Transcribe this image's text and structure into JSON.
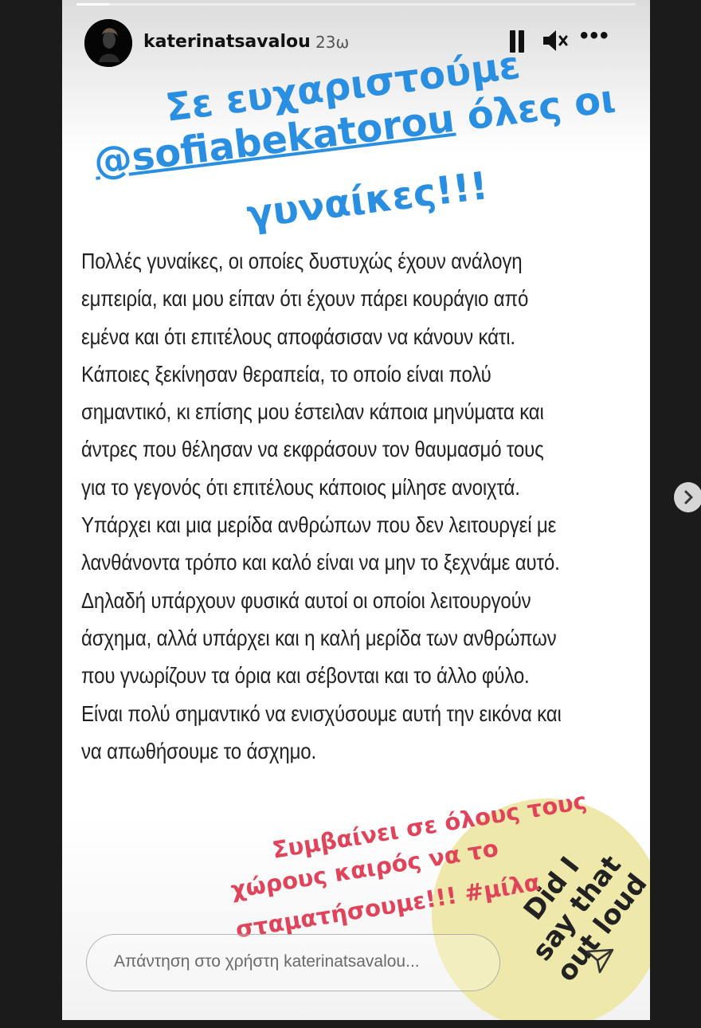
{
  "story": {
    "progress": 0.06,
    "header": {
      "username": "katerinatsavalou",
      "time_ago": "23ω",
      "pause_icon": "pause-icon",
      "mute_icon": "speaker-muted-icon",
      "more_icon": "more-icon",
      "more_label": "•••"
    },
    "sticker_blue": {
      "line1": "Σε ευχαριστούμε",
      "line2_mention": "@sofiabekatorou",
      "line2_rest": " όλες οι",
      "line3": "γυναίκες!!!",
      "color": "#2a8fe0"
    },
    "body_lines": [
      "Πολλές γυναίκες, οι οποίες δυστυχώς έχουν ανάλογη",
      "εμπειρία, και μου είπαν ότι έχουν πάρει κουράγιο από",
      "εμένα και ότι επιτέλους αποφάσισαν να κάνουν κάτι.",
      "Κάποιες ξεκίνησαν θεραπεία, το οποίο είναι πολύ",
      "σημαντικό, κι επίσης μου έστειλαν κάποια μηνύματα και",
      "άντρες που θέλησαν να εκφράσουν τον θαυμασμό τους",
      "για το γεγονός ότι επιτέλους κάποιος μίλησε ανοιχτά.",
      "Υπάρχει και μια μερίδα ανθρώπων που δεν λειτουργεί με",
      "λανθάνοντα τρόπο και καλό είναι να μην το ξεχνάμε αυτό.",
      "Δηλαδή υπάρχουν φυσικά αυτοί οι οποίοι λειτουργούν",
      "άσχημα, αλλά υπάρχει και η καλή μερίδα των ανθρώπων",
      "που γνωρίζουν τα όρια και σέβονται και το άλλο φύλο.",
      "Είναι πολύ σημαντικό να ενισχύσουμε αυτή την εικόνα και",
      "να απωθήσουμε το άσχημο."
    ],
    "sticker_red": {
      "line1": "Συμβαίνει σε όλους τους",
      "line2": "χώρους καιρός να το",
      "line3": "σταματήσουμε!!! #μίλα",
      "color": "#e0445a"
    },
    "circle_sticker": {
      "line1": "Did I",
      "line2": "say that",
      "line3": "out loud",
      "color": "#eee7a6"
    },
    "reply": {
      "placeholder": "Απάντηση στο χρήστη katerinatsavalou..."
    },
    "send_icon": "send-icon",
    "next_icon": "chevron-right-icon"
  }
}
